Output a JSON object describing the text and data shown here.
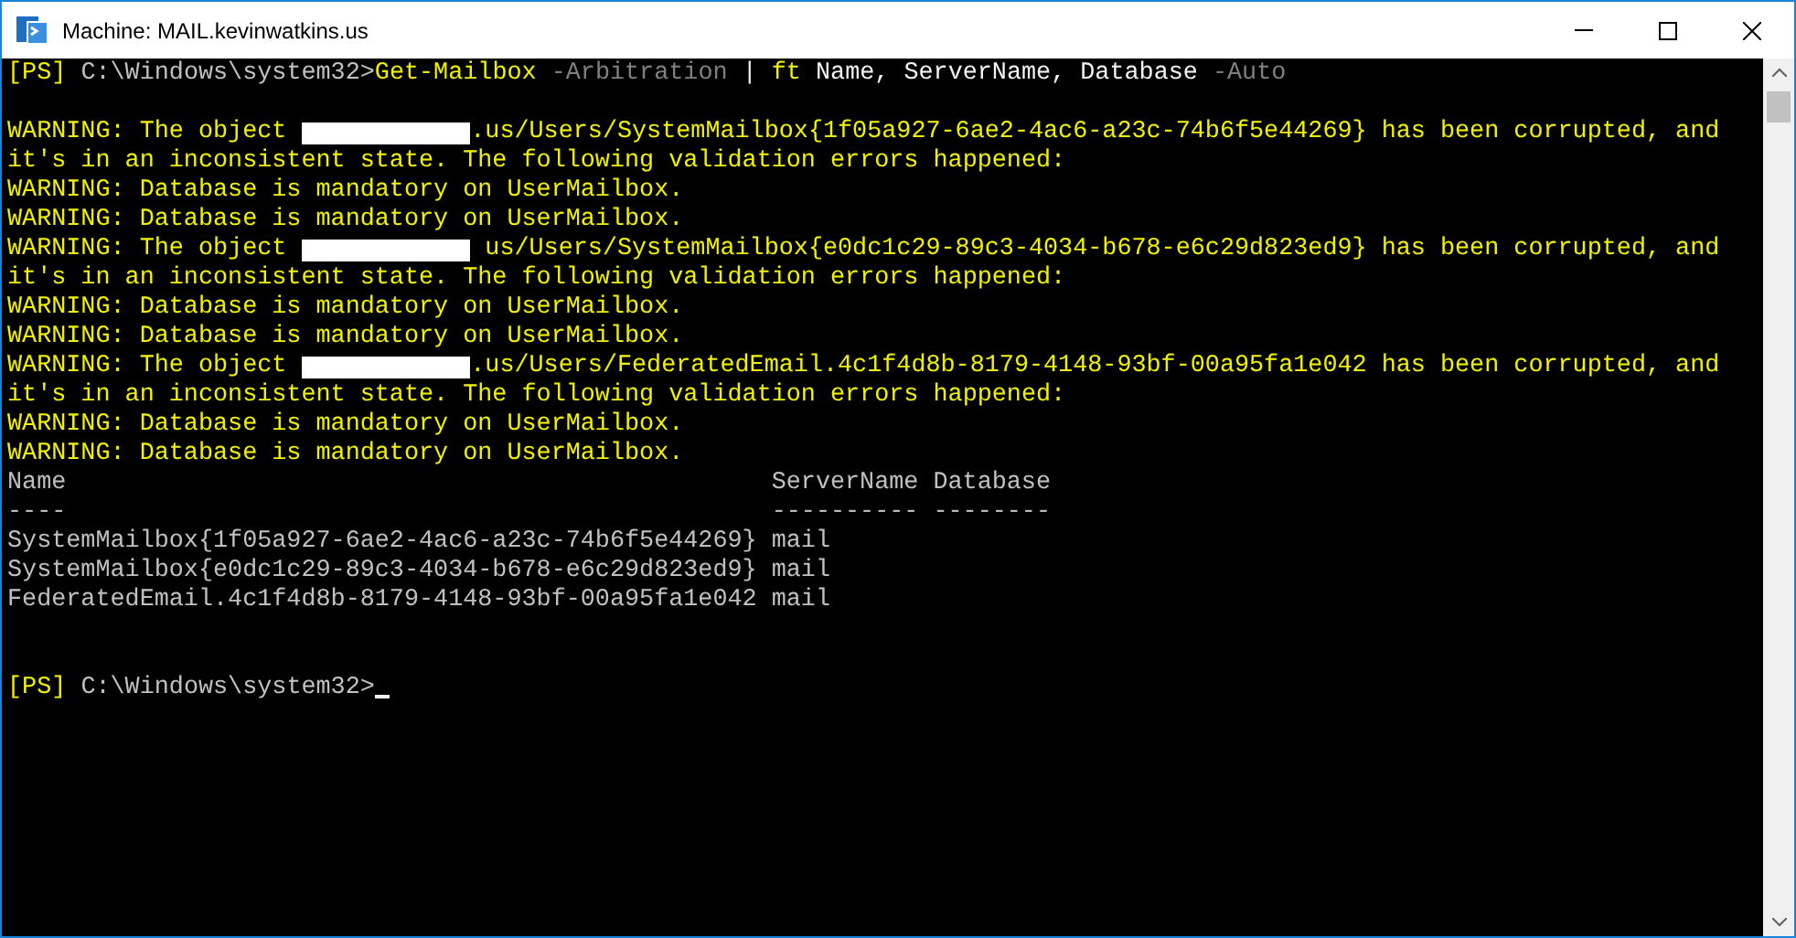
{
  "window": {
    "title": "Machine: MAIL.kevinwatkins.us"
  },
  "console": {
    "command": [
      {
        "text": "[PS]",
        "color": "#f0f000"
      },
      {
        "text": " C:\\Windows\\system32>",
        "color": "#c0c0c0"
      },
      {
        "text": "Get-Mailbox",
        "color": "#f0f000"
      },
      {
        "text": " -Arbitration ",
        "color": "#808080"
      },
      {
        "text": "|",
        "color": "#f2f2f2"
      },
      {
        "text": " ft",
        "color": "#f0f000"
      },
      {
        "text": " Name, ServerName, Database",
        "color": "#f2f2f2"
      },
      {
        "text": " -Auto",
        "color": "#808080"
      }
    ],
    "warnings": [
      {
        "segments": [
          {
            "kind": "text",
            "text": "WARNING: The object "
          },
          {
            "kind": "redaction"
          },
          {
            "kind": "text",
            "text": ".us/Users/SystemMailbox{1f05a927-6ae2-4ac6-a23c-74b6f5e44269} has been corrupted, and"
          }
        ]
      },
      {
        "segments": [
          {
            "kind": "text",
            "text": "it's in an inconsistent state. The following validation errors happened:"
          }
        ]
      },
      {
        "segments": [
          {
            "kind": "text",
            "text": "WARNING: Database is mandatory on UserMailbox."
          }
        ]
      },
      {
        "segments": [
          {
            "kind": "text",
            "text": "WARNING: Database is mandatory on UserMailbox."
          }
        ]
      },
      {
        "segments": [
          {
            "kind": "text",
            "text": "WARNING: The object "
          },
          {
            "kind": "redaction"
          },
          {
            "kind": "text",
            "text": " us/Users/SystemMailbox{e0dc1c29-89c3-4034-b678-e6c29d823ed9} has been corrupted, and"
          }
        ]
      },
      {
        "segments": [
          {
            "kind": "text",
            "text": "it's in an inconsistent state. The following validation errors happened:"
          }
        ]
      },
      {
        "segments": [
          {
            "kind": "text",
            "text": "WARNING: Database is mandatory on UserMailbox."
          }
        ]
      },
      {
        "segments": [
          {
            "kind": "text",
            "text": "WARNING: Database is mandatory on UserMailbox."
          }
        ]
      },
      {
        "segments": [
          {
            "kind": "text",
            "text": "WARNING: The object "
          },
          {
            "kind": "redaction"
          },
          {
            "kind": "text",
            "text": ".us/Users/FederatedEmail.4c1f4d8b-8179-4148-93bf-00a95fa1e042 has been corrupted, and"
          }
        ]
      },
      {
        "segments": [
          {
            "kind": "text",
            "text": "it's in an inconsistent state. The following validation errors happened:"
          }
        ]
      },
      {
        "segments": [
          {
            "kind": "text",
            "text": "WARNING: Database is mandatory on UserMailbox."
          }
        ]
      },
      {
        "segments": [
          {
            "kind": "text",
            "text": "WARNING: Database is mandatory on UserMailbox."
          }
        ]
      }
    ],
    "table": {
      "columns": [
        "Name",
        "ServerName",
        "Database"
      ],
      "underlines": [
        "----",
        "----------",
        "--------"
      ],
      "rows": [
        [
          "SystemMailbox{1f05a927-6ae2-4ac6-a23c-74b6f5e44269}",
          "mail"
        ],
        [
          "SystemMailbox{e0dc1c29-89c3-4034-b678-e6c29d823ed9}",
          "mail"
        ],
        [
          "FederatedEmail.4c1f4d8b-8179-4148-93bf-00a95fa1e042",
          "mail"
        ]
      ]
    },
    "prompt": [
      {
        "text": "[PS]",
        "color": "#f0f000"
      },
      {
        "text": " C:\\Windows\\system32>",
        "color": "#c0c0c0"
      }
    ]
  }
}
